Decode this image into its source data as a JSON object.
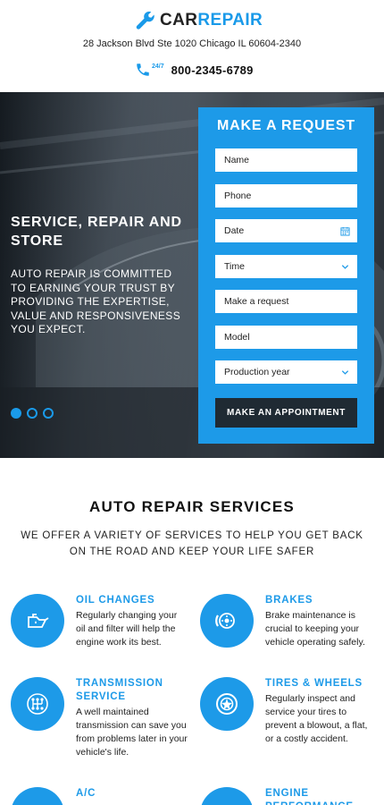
{
  "header": {
    "logo_car": "CAR",
    "logo_repair": "REPAIR",
    "address": "28 Jackson Blvd Ste 1020 Chicago IL 60604-2340",
    "phone_badge": "24/7",
    "phone_number": "800-2345-6789"
  },
  "hero": {
    "title": "SERVICE, REPAIR AND STORE",
    "description": "AUTO REPAIR IS COMMITTED TO EARNING YOUR TRUST BY PROVIDING THE EXPERTISE, VALUE AND RESPONSIVENESS YOU EXPECT.",
    "slides": 3,
    "active_slide": 1
  },
  "form": {
    "title": "MAKE A REQUEST",
    "fields": {
      "name": "Name",
      "phone": "Phone",
      "date": "Date",
      "time": "Time",
      "request": "Make a request",
      "model": "Model",
      "year": "Production year"
    },
    "submit_label": "MAKE AN APPOINTMENT"
  },
  "services": {
    "title": "AUTO REPAIR SERVICES",
    "subtitle": "WE OFFER A VARIETY OF SERVICES TO HELP YOU GET BACK ON THE ROAD AND KEEP YOUR LIFE SAFER",
    "items": [
      {
        "title": "OIL CHANGES",
        "text": "Regularly changing your oil and filter will help the engine work its best.",
        "icon": "oil-can-icon"
      },
      {
        "title": "BRAKES",
        "text": "Brake maintenance is crucial to keeping your vehicle operating safely.",
        "icon": "brake-disc-icon"
      },
      {
        "title": "TRANSMISSION SERVICE",
        "text": "A well maintained transmission can save you from problems later in your vehicle's life.",
        "icon": "gearbox-icon"
      },
      {
        "title": "TIRES & WHEELS",
        "text": "Regularly inspect and service your tires to prevent a blowout, a flat, or a costly accident.",
        "icon": "wheel-icon"
      },
      {
        "title": "A/C",
        "text": "",
        "icon": "fan-icon"
      },
      {
        "title": "ENGINE PERFORMANCE",
        "text": "",
        "icon": "engine-icon"
      }
    ]
  },
  "colors": {
    "accent": "#1d9ae8",
    "dark_button": "#1f2a33"
  }
}
